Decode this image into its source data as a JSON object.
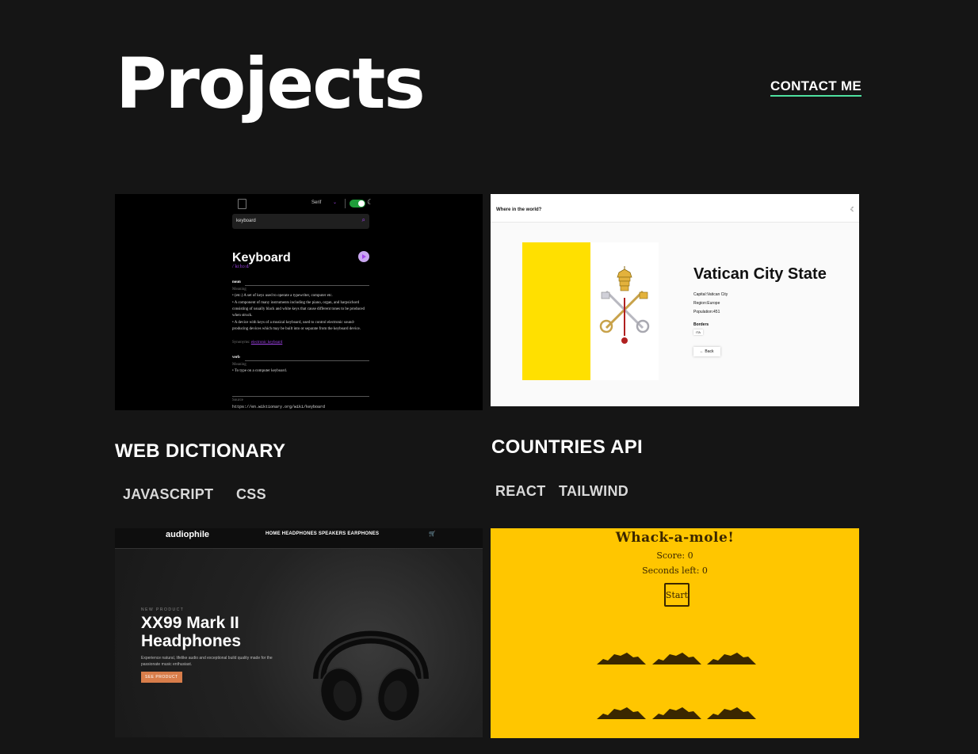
{
  "header": {
    "title": "Projects",
    "contact_label": "CONTACT ME"
  },
  "projects": [
    {
      "title": "WEB DICTIONARY",
      "tags": [
        "JAVASCRIPT",
        "CSS"
      ]
    },
    {
      "title": "COUNTRIES API",
      "tags": [
        "REACT",
        "TAILWIND"
      ]
    }
  ],
  "dictionary_thumb": {
    "font": "Serif",
    "search_value": "keyboard",
    "word": "Keyboard",
    "phonetic": "/ˈkiːbɔːd/",
    "noun_label": "noun",
    "verb_label": "verb",
    "meaning_label": "Meaning",
    "noun_defs": [
      "(etc.) A set of keys used to operate a typewriter, computer etc.",
      "A component of many instruments including the piano, organ, and harpsichord consisting of usually black and white keys that cause different tones to be produced when struck.",
      "A device with keys of a musical keyboard, used to control electronic sound-producing devices which may be built into or separate from the keyboard device."
    ],
    "synonyms_label": "Synonyms:",
    "synonym": "electronic keyboard",
    "verb_defs": [
      "To type on a computer keyboard."
    ],
    "source_label": "Source",
    "source_url": "https://en.wiktionary.org/wiki/keyboard"
  },
  "countries_thumb": {
    "brand": "Where in the world?",
    "country": "Vatican City State",
    "capital": "Capital:Vatican City",
    "region": "Region:Europe",
    "population": "Population:451",
    "borders_label": "Borders",
    "border_chip": "ITA",
    "back_label": "← Back",
    "colors": {
      "flag_yellow": "#ffe000"
    }
  },
  "audiophile_thumb": {
    "logo": "audiophile",
    "nav_links": "HOME   HEADPHONES   SPEAKERS   EARPHONES",
    "overline": "NEW PRODUCT",
    "headline": "XX99 Mark II Headphones",
    "description": "Experience natural, lifelike audio and exceptional build quality made for the passionate music enthusiast.",
    "cta": "SEE PRODUCT",
    "colors": {
      "accent": "#d87d4a"
    }
  },
  "mole_thumb": {
    "title": "Whack-a-mole!",
    "score": "Score: 0",
    "seconds": "Seconds left: 0",
    "start": "Start",
    "colors": {
      "background": "#ffc600"
    }
  }
}
